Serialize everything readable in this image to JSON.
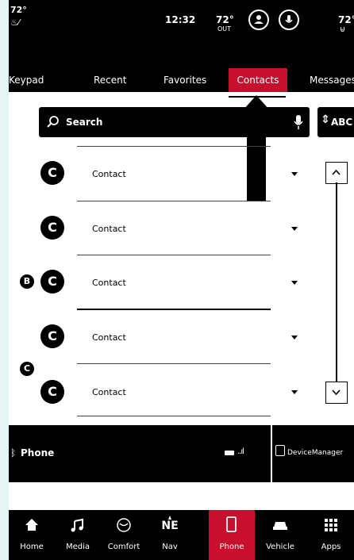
{
  "status": {
    "left_temp": "72°",
    "time": "12:32",
    "outside_temp": "72°",
    "outside_label": "OUT",
    "right_temp": "72°"
  },
  "tabs": [
    {
      "label": "Keypad"
    },
    {
      "label": "Recent"
    },
    {
      "label": "Favorites"
    },
    {
      "label": "Contacts",
      "active": true
    },
    {
      "label": "Messages"
    }
  ],
  "search": {
    "label": "Search",
    "abc_label": "ABC"
  },
  "contacts": [
    {
      "initial": "C",
      "name": "Contact"
    },
    {
      "initial": "C",
      "name": "Contact"
    },
    {
      "initial": "C",
      "name": "Contact"
    },
    {
      "initial": "C",
      "name": "Contact"
    },
    {
      "initial": "C",
      "name": "Contact"
    }
  ],
  "markers": {
    "b": "B",
    "c": "C"
  },
  "phone_bar": {
    "label": "Phone",
    "device_manager": "DeviceManager"
  },
  "nav": [
    {
      "label": "Home",
      "icon": "home-icon"
    },
    {
      "label": "Media",
      "icon": "music-note-icon"
    },
    {
      "label": "Comfort",
      "icon": "comfort-icon"
    },
    {
      "label": "Nav",
      "icon": "compass-icon",
      "heading": "NE"
    },
    {
      "label": "Phone",
      "icon": "phone-icon",
      "active": true
    },
    {
      "label": "Vehicle",
      "icon": "vehicle-icon"
    },
    {
      "label": "Apps",
      "icon": "apps-grid-icon"
    }
  ],
  "colors": {
    "accent": "#c8102e",
    "bar": "#000000",
    "background": "#e7f4f4"
  }
}
